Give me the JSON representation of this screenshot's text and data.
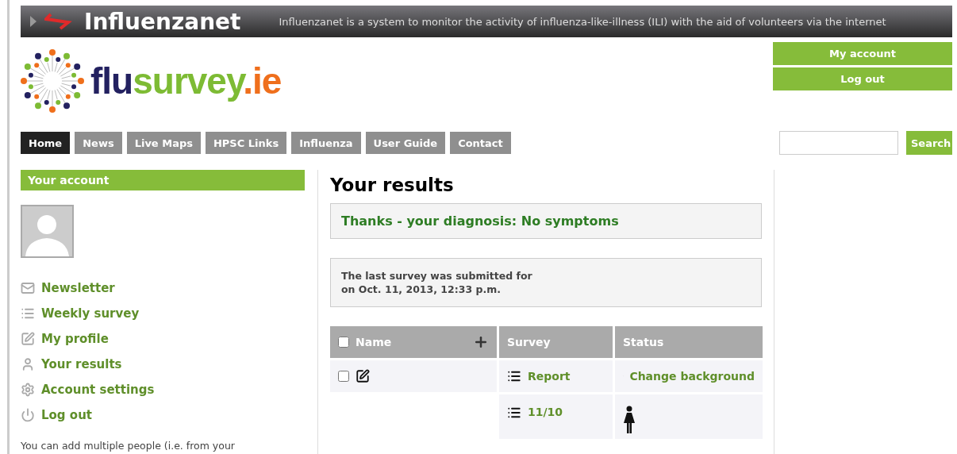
{
  "top_bar": {
    "brand": "Influenzanet",
    "tagline": "Influenzanet is a system to monitor the activity of influenza-like-illness (ILI) with the aid of volunteers via the internet"
  },
  "logo": {
    "parts": [
      {
        "text": "flu",
        "color": "#232160"
      },
      {
        "text": "survey",
        "color": "#7dbb34"
      },
      {
        "text": ".ie",
        "color": "#ef6f1c"
      }
    ]
  },
  "account_buttons": [
    "My account",
    "Log out"
  ],
  "nav": [
    {
      "label": "Home",
      "selected": true
    },
    {
      "label": "News",
      "selected": false
    },
    {
      "label": "Live Maps",
      "selected": false
    },
    {
      "label": "HPSC Links",
      "selected": false
    },
    {
      "label": "Influenza",
      "selected": false
    },
    {
      "label": "User Guide",
      "selected": false
    },
    {
      "label": "Contact",
      "selected": false
    }
  ],
  "search": {
    "button": "Search"
  },
  "sidebar": {
    "title": "Your account",
    "items": [
      {
        "label": "Newsletter"
      },
      {
        "label": "Weekly survey"
      },
      {
        "label": "My profile"
      },
      {
        "label": "Your results"
      },
      {
        "label": "Account settings"
      },
      {
        "label": "Log out"
      }
    ],
    "note": "You can add multiple people (i.e. from your"
  },
  "main": {
    "title": "Your results",
    "diagnosis": "Thanks - your diagnosis: No symptoms",
    "last_survey": [
      "The last survey was submitted for",
      "on Oct. 11, 2013, 12:33 p.m."
    ],
    "table": {
      "select_all_checked": false,
      "columns": [
        "Name",
        "Survey",
        "Status"
      ],
      "rows": [
        {
          "kind": "edit",
          "checked": false,
          "survey": "Report",
          "status": "Change background"
        },
        {
          "kind": "figure",
          "survey": "11/10"
        }
      ]
    }
  }
}
